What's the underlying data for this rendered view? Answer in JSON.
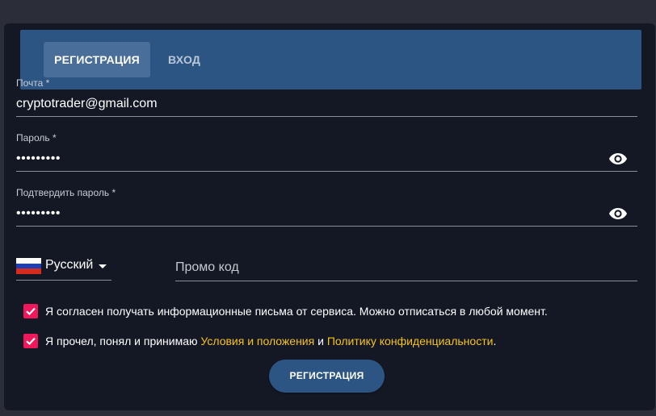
{
  "tabs": {
    "register": "РЕГИСТРАЦИЯ",
    "login": "ВХОД"
  },
  "email": {
    "label": "Почта *",
    "value": "cryptotrader@gmail.com"
  },
  "password": {
    "label": "Пароль *",
    "value": "•••••••••"
  },
  "confirm_password": {
    "label": "Подтвердить пароль *",
    "value": "•••••••••"
  },
  "language": {
    "selected": "Русский",
    "flag_colors": [
      "#ffffff",
      "#1c3fb8",
      "#d52b1e"
    ]
  },
  "promo": {
    "placeholder": "Промо код"
  },
  "consent_newsletter": {
    "checked": true,
    "text": "Я согласен получать информационные письма от сервиса. Можно отписаться в любой момент."
  },
  "consent_terms": {
    "checked": true,
    "prefix": "Я прочел, понял и принимаю ",
    "terms_link": "Условия и положения",
    "conjunction": " и ",
    "privacy_link": "Политику конфиденциальности",
    "suffix": "."
  },
  "submit": {
    "label": "РЕГИСТРАЦИЯ"
  },
  "colors": {
    "accent_blue": "#2c5583",
    "checkbox": "#f0185a",
    "link": "#f6c21b"
  }
}
